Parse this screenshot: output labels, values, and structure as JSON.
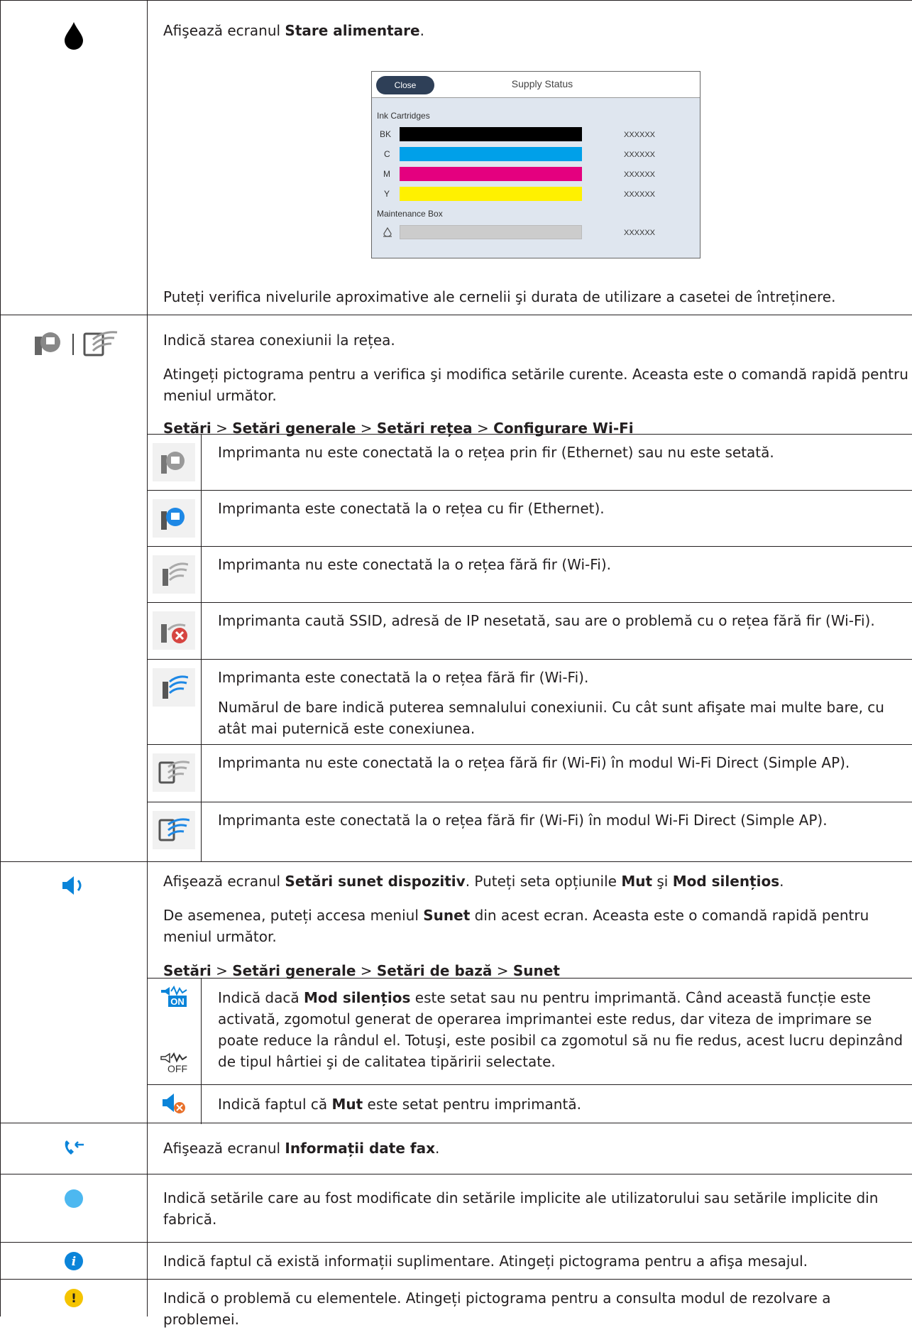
{
  "colors": {
    "border": "#231f20",
    "ink_black": "#000000",
    "cyan": "#00a0e9",
    "magenta": "#e4007f",
    "yellow": "#fff100",
    "maint": "#cccccc",
    "blue_icon": "#0b84d9",
    "light_blue_dot": "#4db8f0",
    "yellow_icon": "#f5c400"
  },
  "row1": {
    "icon": "ink-drop-icon",
    "intro_pre": "Afişează ecranul ",
    "intro_bold": "Stare alimentare",
    "intro_post": ".",
    "screen": {
      "close": "Close",
      "title": "Supply Status",
      "cartridges_label": "Ink Cartridges",
      "bars": [
        {
          "label": "BK",
          "value": "XXXXXX",
          "color": "#000000"
        },
        {
          "label": "C",
          "value": "XXXXXX",
          "color": "#00a0e9"
        },
        {
          "label": "M",
          "value": "XXXXXX",
          "color": "#e4007f"
        },
        {
          "label": "Y",
          "value": "XXXXXX",
          "color": "#fff100"
        }
      ],
      "maintenance_label": "Maintenance Box",
      "maintenance_value": "XXXXXX"
    },
    "footer": "Puteți verifica nivelurile aproximative ale cernelii şi durata de utilizare a casetei de întreținere."
  },
  "row2": {
    "icon": "network-status-icon",
    "line1": "Indică starea conexiunii la rețea.",
    "line2": "Atingeți pictograma pentru a verifica şi modifica setările curente. Aceasta este o comandă rapidă pentru meniul următor.",
    "path": [
      {
        "bold": "Setări",
        "sep": " > "
      },
      {
        "bold": "Setări generale",
        "sep": " > "
      },
      {
        "bold": "Setări rețea",
        "sep": " > "
      },
      {
        "bold": "Configurare Wi-Fi",
        "sep": ""
      }
    ],
    "subs": [
      {
        "icon": "ethernet-disconnected-icon",
        "text": "Imprimanta nu este conectată la o rețea prin fir (Ethernet) sau nu este setată."
      },
      {
        "icon": "ethernet-connected-icon",
        "text": "Imprimanta este conectată la o rețea cu fir (Ethernet)."
      },
      {
        "icon": "wifi-disconnected-icon",
        "text": "Imprimanta nu este conectată la o rețea fără fir (Wi-Fi)."
      },
      {
        "icon": "wifi-error-icon",
        "text": "Imprimanta caută SSID, adresă de IP nesetată, sau are o problemă cu o rețea fără fir (Wi-Fi)."
      },
      {
        "icon": "wifi-connected-icon",
        "text": "Imprimanta este conectată la o rețea fără fir (Wi-Fi).",
        "text2": "Numărul de bare indică puterea semnalului conexiunii. Cu cât sunt afişate mai multe bare, cu atât mai puternică este conexiunea."
      },
      {
        "icon": "wifi-direct-disconnected-icon",
        "text": "Imprimanta nu este conectată la o rețea fără fir (Wi-Fi) în modul Wi-Fi Direct (Simple AP)."
      },
      {
        "icon": "wifi-direct-connected-icon",
        "text": "Imprimanta este conectată la o rețea fără fir (Wi-Fi) în modul Wi-Fi Direct (Simple AP)."
      }
    ]
  },
  "row3": {
    "icon": "speaker-icon",
    "l1_pre": "Afişează ecranul ",
    "l1_b1": "Setări sunet dispozitiv",
    "l1_mid": ". Puteți seta opțiunile ",
    "l1_b2": "Mut",
    "l1_and": " şi ",
    "l1_b3": "Mod silențios",
    "l1_post": ".",
    "l2_pre": "De asemenea, puteți accesa meniul ",
    "l2_b": "Sunet",
    "l2_post": " din acest ecran. Aceasta este o comandă rapidă pentru meniul următor.",
    "path": [
      {
        "bold": "Setări",
        "sep": " > "
      },
      {
        "bold": "Setări generale",
        "sep": " > "
      },
      {
        "bold": "Setări de bază",
        "sep": " > "
      },
      {
        "bold": "Sunet",
        "sep": ""
      }
    ],
    "sub1": {
      "on_label": "ON",
      "off_label": "OFF",
      "pre": "Indică dacă ",
      "bold": "Mod silențios",
      "post": " este setat sau nu pentru imprimantă. Când această funcție este activată, zgomotul generat de operarea imprimantei este redus, dar viteza de imprimare se poate reduce la rândul el. Totuşi, este posibil ca zgomotul să nu fie redus, acest lucru depinzând de tipul hârtiei şi de calitatea tipăririi selectate."
    },
    "sub2": {
      "pre": "Indică faptul că ",
      "bold": "Mut",
      "post": " este setat pentru imprimantă."
    }
  },
  "row4": {
    "icon": "fax-info-icon",
    "pre": "Afişează ecranul ",
    "bold": "Informații date fax",
    "post": "."
  },
  "row5": {
    "icon": "blue-dot-icon",
    "text": "Indică setările care au fost modificate din setările implicite ale utilizatorului sau setările implicite din fabrică."
  },
  "row6": {
    "icon": "info-icon",
    "text": "Indică faptul că există informații suplimentare. Atingeți pictograma pentru a afişa mesajul."
  },
  "row7": {
    "icon": "warning-icon",
    "text": "Indică o problemă cu elementele. Atingeți pictograma pentru a consulta modul de rezolvare a problemei."
  }
}
